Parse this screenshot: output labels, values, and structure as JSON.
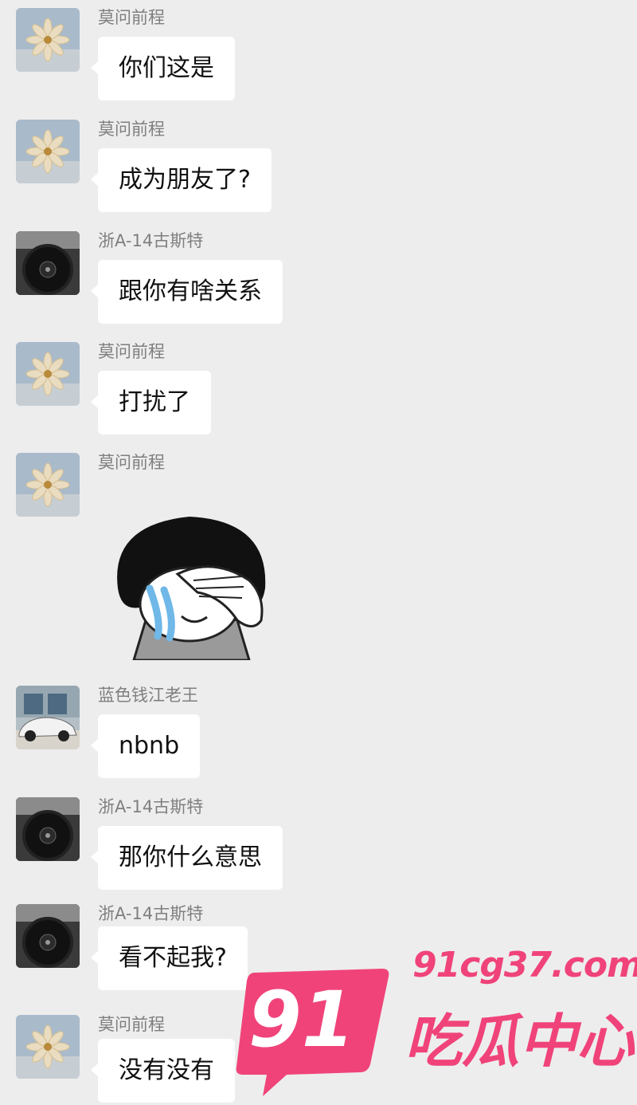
{
  "messages": [
    {
      "sender": "莫问前程",
      "text": "你们这是",
      "avatar_icon": "flower-avatar-icon"
    },
    {
      "sender": "莫问前程",
      "text": "成为朋友了?",
      "avatar_icon": "flower-avatar-icon"
    },
    {
      "sender": "浙A-14古斯特",
      "text": "跟你有啥关系",
      "avatar_icon": "steering-wheel-avatar-icon"
    },
    {
      "sender": "莫问前程",
      "text": "打扰了",
      "avatar_icon": "flower-avatar-icon"
    },
    {
      "sender": "莫问前程",
      "sticker": "crying-face-sticker",
      "avatar_icon": "flower-avatar-icon"
    },
    {
      "sender": "蓝色钱江老王",
      "text": "nbnb",
      "avatar_icon": "car-avatar-icon"
    },
    {
      "sender": "浙A-14古斯特",
      "text": "那你什么意思",
      "avatar_icon": "steering-wheel-avatar-icon"
    },
    {
      "sender": "浙A-14古斯特",
      "text": "看不起我?",
      "avatar_icon": "steering-wheel-avatar-icon"
    },
    {
      "sender": "莫问前程",
      "text": "没有没有",
      "avatar_icon": "flower-avatar-icon"
    }
  ],
  "watermark": {
    "number": "91",
    "url": "91cg37.com",
    "brand": "吃瓜中心",
    "color": "#f0437a"
  }
}
